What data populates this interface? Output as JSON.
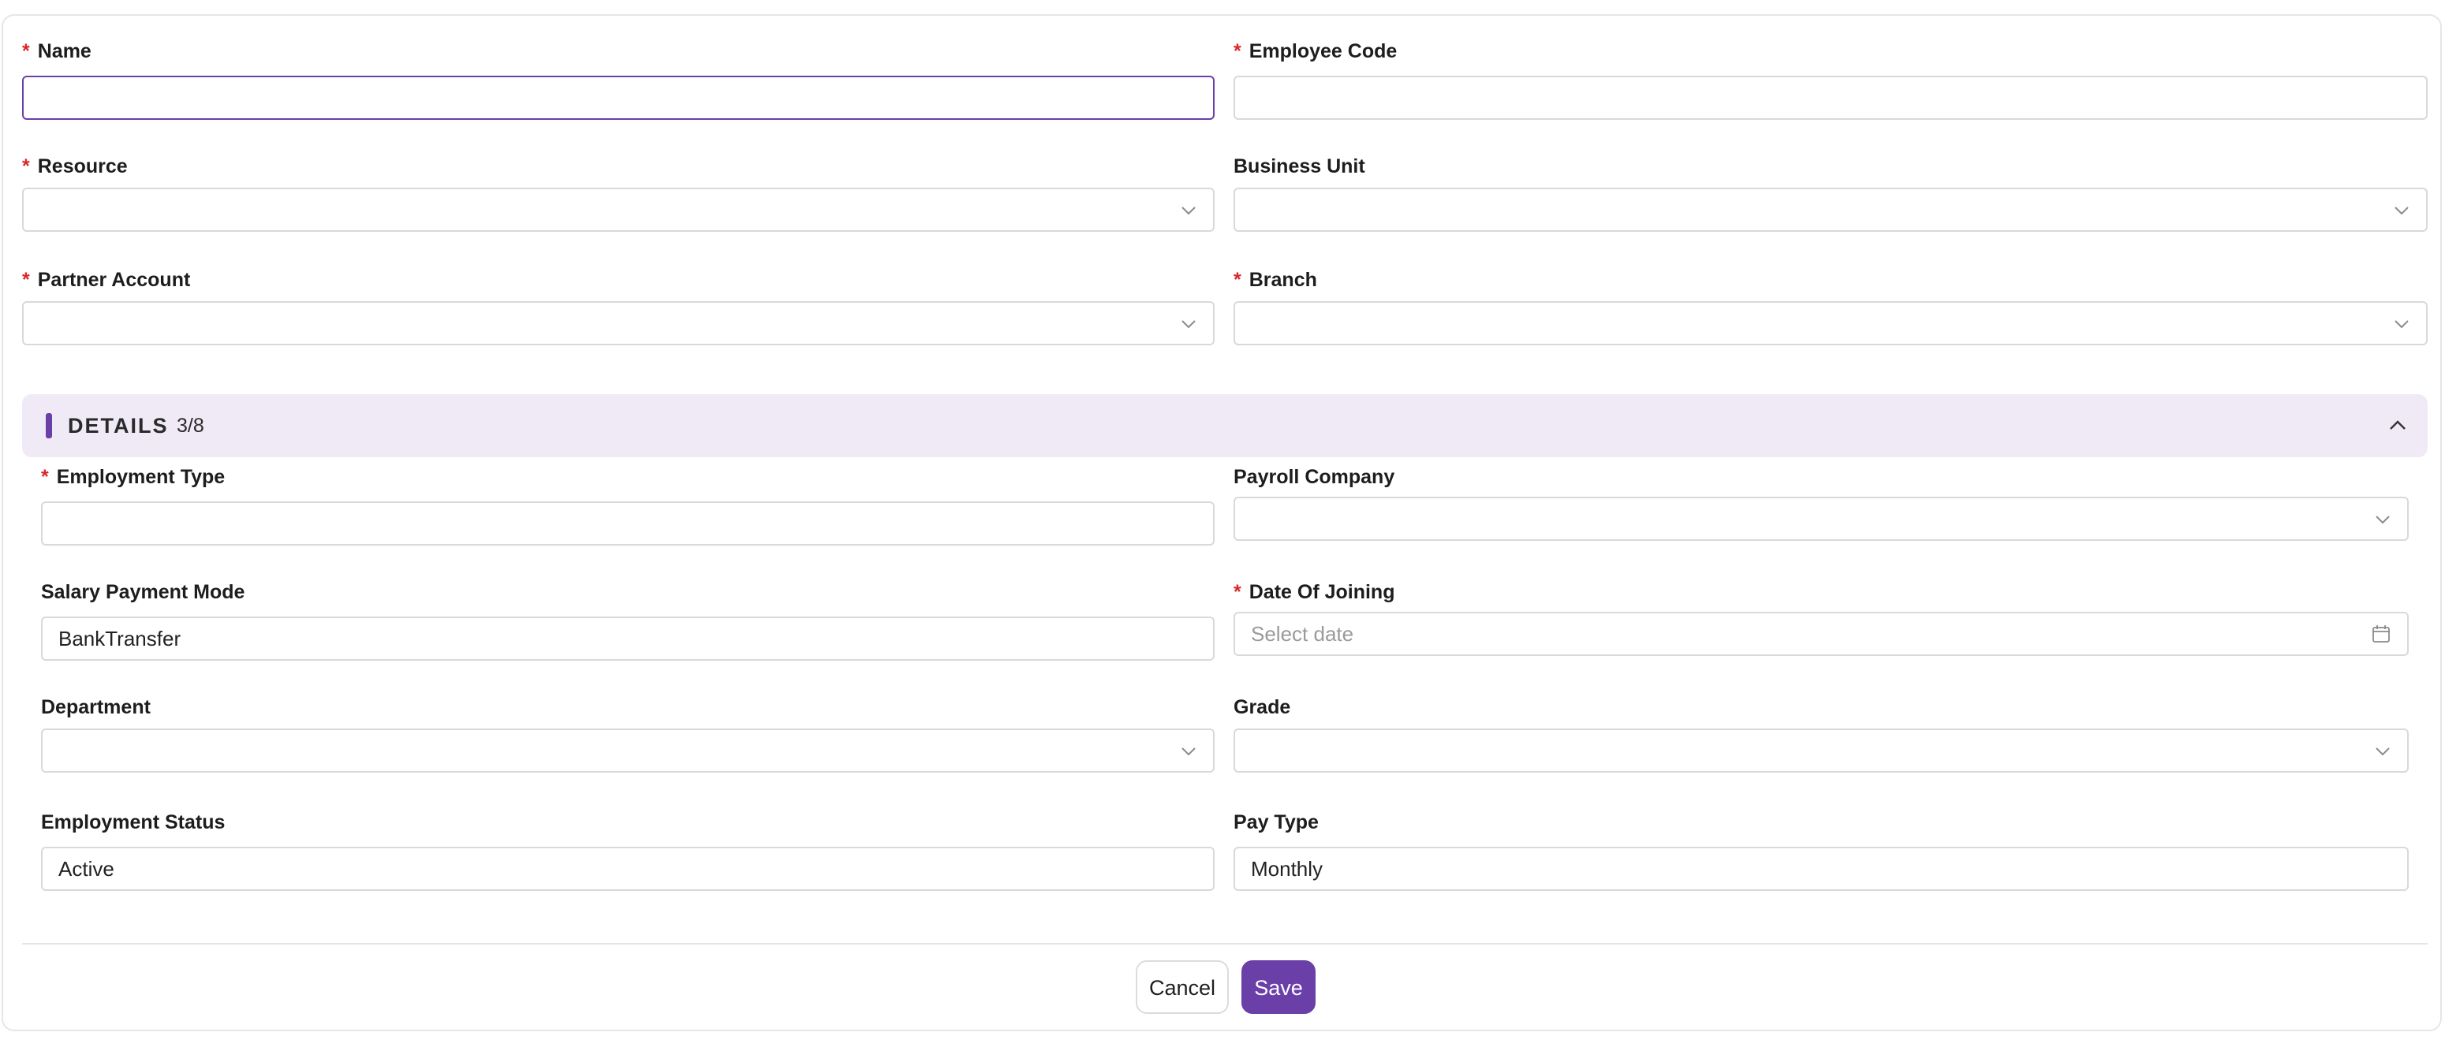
{
  "form": {
    "name": {
      "label": "Name",
      "required": "*",
      "value": ""
    },
    "employee_code": {
      "label": "Employee Code",
      "required": "*",
      "value": ""
    },
    "resource": {
      "label": "Resource",
      "required": "*",
      "value": ""
    },
    "business_unit": {
      "label": "Business Unit",
      "value": ""
    },
    "partner_account": {
      "label": "Partner Account",
      "required": "*",
      "value": ""
    },
    "branch": {
      "label": "Branch",
      "required": "*",
      "value": ""
    }
  },
  "details": {
    "title": "DETAILS",
    "count": "3/8",
    "employment_type": {
      "label": "Employment Type",
      "required": "*",
      "value": ""
    },
    "payroll_company": {
      "label": "Payroll Company",
      "value": ""
    },
    "salary_payment_mode": {
      "label": "Salary Payment Mode",
      "value": "BankTransfer"
    },
    "date_of_joining": {
      "label": "Date Of Joining",
      "required": "*",
      "placeholder": "Select date"
    },
    "department": {
      "label": "Department",
      "value": ""
    },
    "grade": {
      "label": "Grade",
      "value": ""
    },
    "employment_status": {
      "label": "Employment Status",
      "value": "Active"
    },
    "pay_type": {
      "label": "Pay Type",
      "value": "Monthly"
    }
  },
  "actions": {
    "cancel": "Cancel",
    "save": "Save"
  },
  "colors": {
    "accent": "#6b3fa8",
    "required": "#d9262b",
    "section_bg": "#efeaf6"
  },
  "icons": {
    "dropdown": "chevron-down-icon",
    "collapse": "chevron-up-icon",
    "calendar": "calendar-icon"
  }
}
